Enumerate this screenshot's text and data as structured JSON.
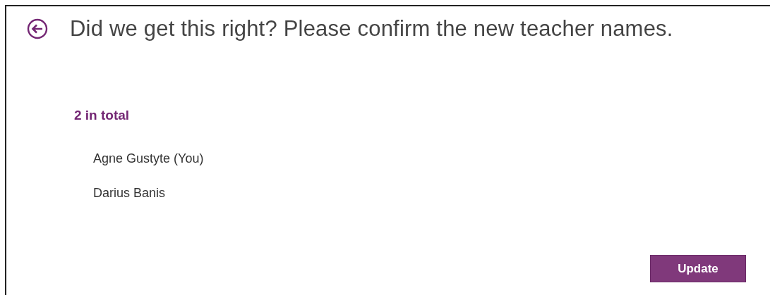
{
  "header": {
    "title": "Did we get this right? Please confirm the new teacher names."
  },
  "summary": {
    "count": "2 in total"
  },
  "teachers": [
    {
      "name": "Agne Gustyte (You)"
    },
    {
      "name": "Darius Banis"
    }
  ],
  "buttons": [
    {
      "label": "Update"
    }
  ]
}
